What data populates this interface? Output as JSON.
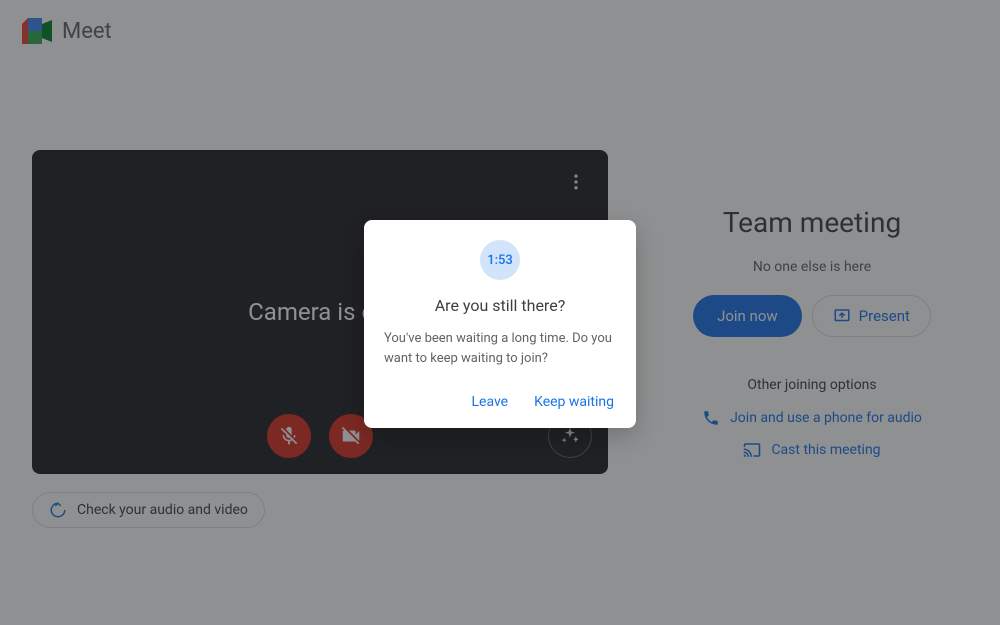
{
  "header": {
    "product": "Meet"
  },
  "preview": {
    "camera_off": "Camera is off"
  },
  "check_av": {
    "label": "Check your audio and video"
  },
  "meeting": {
    "title": "Team meeting",
    "subtext": "No one else is here",
    "join": "Join now",
    "present": "Present",
    "other_heading": "Other joining options",
    "phone_link": "Join and use a phone for audio",
    "cast_link": "Cast this meeting"
  },
  "dialog": {
    "timer": "1:53",
    "title": "Are you still there?",
    "body": "You've been waiting a long time. Do you want to keep waiting to join?",
    "leave": "Leave",
    "keep": "Keep waiting"
  }
}
